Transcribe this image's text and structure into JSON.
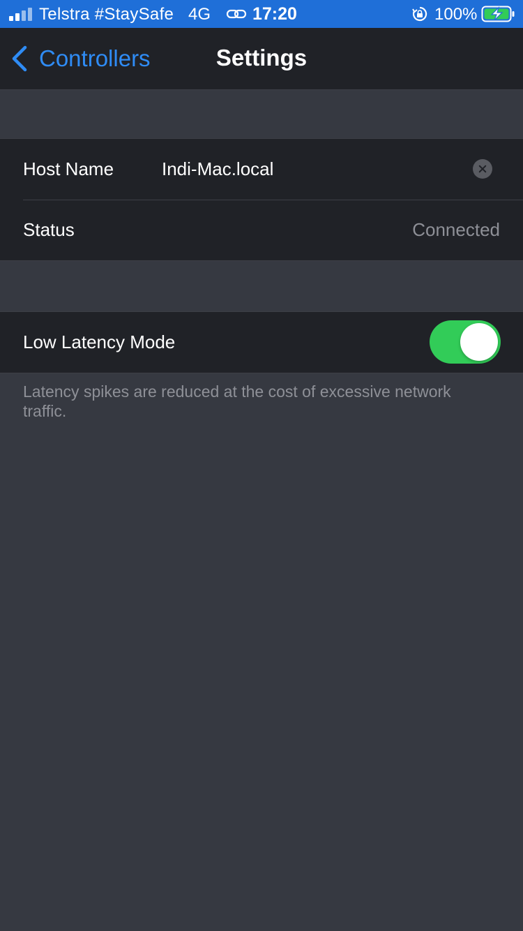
{
  "status_bar": {
    "carrier": "Telstra #StaySafe",
    "network": "4G",
    "time": "17:20",
    "battery": "100%",
    "link_icon": "link-icon",
    "lock_icon": "orientation-lock-icon",
    "battery_icon": "battery-charging-icon"
  },
  "nav": {
    "back_label": "Controllers",
    "back_icon": "chevron-left-icon",
    "title": "Settings"
  },
  "connection": {
    "host_label": "Host Name",
    "host_value": "Indi-Mac.local",
    "clear_icon": "clear-icon",
    "status_label": "Status",
    "status_value": "Connected"
  },
  "latency": {
    "label": "Low Latency Mode",
    "enabled": true,
    "footnote": "Latency spikes are reduced at the cost of excessive network traffic."
  },
  "colors": {
    "accent": "#2f8cf5",
    "status_bar": "#1f6fd8",
    "toggle_on": "#32cc58",
    "background": "#363941",
    "cell": "#202227"
  }
}
